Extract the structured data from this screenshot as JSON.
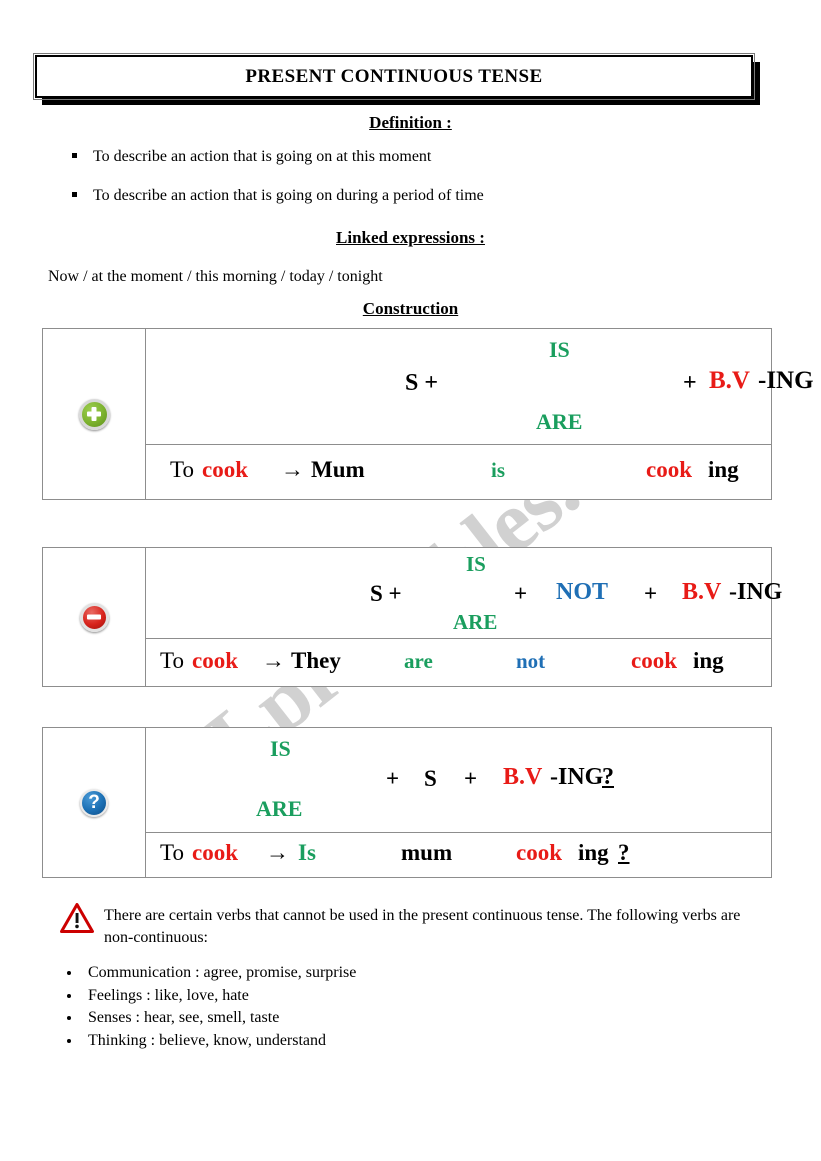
{
  "document": {
    "title": "PRESENT CONTINUOUS TENSE",
    "watermark": "ESLprintables.com"
  },
  "definition": {
    "heading": "Definition :",
    "items": [
      "To describe an action that is going on at this moment",
      "To describe an action that is going on during a period of time"
    ]
  },
  "linked_expressions": {
    "heading": "Linked expressions :",
    "text": "Now / at the moment / this morning / today / tonight"
  },
  "construction": {
    "heading": "Construction",
    "tables": [
      {
        "form": "affirmative",
        "icon": "plus-circle-icon",
        "formula": {
          "subject": "S +",
          "aux_top": "IS",
          "aux_bottom": "ARE",
          "plus": "+",
          "verb_stem": "B.V",
          "verb_suffix": "-ING"
        },
        "example": {
          "to": "To ",
          "verb": "cook",
          "arrow": "→",
          "subject": "Mum",
          "aux": "is",
          "verb_stem": "cook",
          "verb_suffix": "ing"
        }
      },
      {
        "form": "negative",
        "icon": "minus-circle-icon",
        "formula": {
          "subject": "S +",
          "aux_top": "IS",
          "aux_bottom": "ARE",
          "plus1": "+",
          "not": "NOT",
          "plus2": "+",
          "verb_stem": "B.V",
          "verb_suffix": "-ING"
        },
        "example": {
          "to": "To ",
          "verb": "cook",
          "arrow": "→",
          "subject": "They",
          "aux": "are",
          "not": "not",
          "verb_stem": "cook",
          "verb_suffix": "ing"
        }
      },
      {
        "form": "interrogative",
        "icon": "question-circle-icon",
        "formula": {
          "aux_top": "IS",
          "aux_bottom": "ARE",
          "plus1": "+",
          "subject": "S",
          "plus2": "+",
          "verb_stem": "B.V",
          "verb_suffix": "-ING",
          "question_mark": "?"
        },
        "example": {
          "to": "To ",
          "verb": "cook",
          "arrow": "→",
          "aux": "Is",
          "subject": "mum",
          "verb_stem": "cook",
          "verb_suffix": "ing",
          "question_mark": "?"
        }
      }
    ]
  },
  "warning": {
    "icon": "warning-triangle-icon",
    "text": "There are certain verbs that cannot be used in the present continuous tense. The following verbs are non-continuous:",
    "verb_groups": [
      "Communication : agree, promise, surprise",
      "Feelings : like, love, hate",
      "Senses : hear, see, smell, taste",
      "Thinking : believe, know, understand"
    ]
  },
  "colors": {
    "green": "#1a9e5e",
    "red": "#e81b17",
    "blue": "#1f6fb5",
    "black": "#000000",
    "watermark_gray": "#c9c9c9"
  }
}
